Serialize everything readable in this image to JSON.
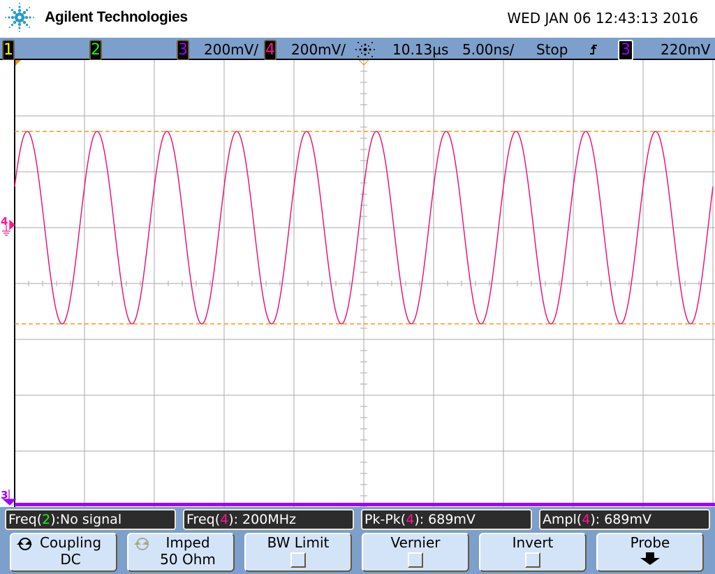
{
  "header": {
    "brand": "Agilent Technologies",
    "datetime": "WED JAN 06 12:43:13 2016"
  },
  "status": {
    "channels": [
      {
        "label": "1",
        "color": "#ffff00"
      },
      {
        "label": "2",
        "color": "#22ee22"
      },
      {
        "label": "3",
        "color": "#a000ff",
        "scale": "200mV/"
      },
      {
        "label": "4",
        "color": "#ff1493",
        "scale": "200mV/"
      }
    ],
    "delay": "10.13µs",
    "timebase": "5.00ns/",
    "run_state": "Stop",
    "trigger_slope_icon": "rising-edge-icon",
    "trigger_source": "3",
    "trigger_level": "220mV"
  },
  "markers": {
    "ch4": "4",
    "ch3": "3"
  },
  "chart_data": {
    "type": "line",
    "series": [
      {
        "channel": "4",
        "shape": "sine",
        "frequency_hz": 200000000,
        "pk_pk_mv": 689,
        "offset_divs_above_center": 1,
        "color": "#e8187a"
      }
    ],
    "volts_per_div_mv": 200,
    "time_per_div_ns": 5,
    "grid": true,
    "divisions": {
      "x": 10,
      "y": 8
    },
    "cursor_color": "#ff8c00"
  },
  "measurements": [
    {
      "prefix": "Freq(",
      "ch": "2",
      "chcolor": "#22ee22",
      "suffix": "):No signal"
    },
    {
      "prefix": "Freq(",
      "ch": "4",
      "chcolor": "#ff1493",
      "suffix": "): 200MHz"
    },
    {
      "prefix": "Pk-Pk(",
      "ch": "4",
      "chcolor": "#ff1493",
      "suffix": "): 689mV"
    },
    {
      "prefix": "Ampl(",
      "ch": "4",
      "chcolor": "#ff1493",
      "suffix": "): 689mV"
    }
  ],
  "softkeys": [
    {
      "label": "Coupling",
      "value": "DC"
    },
    {
      "label": "Imped",
      "value": "50 Ohm"
    },
    {
      "label": "BW Limit"
    },
    {
      "label": "Vernier"
    },
    {
      "label": "Invert"
    },
    {
      "label": "Probe"
    }
  ]
}
